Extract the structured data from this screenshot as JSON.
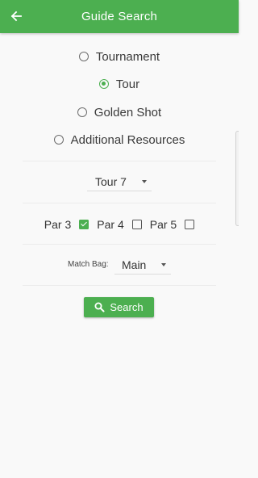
{
  "appbar": {
    "title": "Guide Search",
    "back_icon": "arrow-left-icon"
  },
  "colors": {
    "accent": "#4caf50",
    "background": "#f9f9f9"
  },
  "search_type": {
    "options": [
      {
        "label": "Tournament",
        "selected": false
      },
      {
        "label": "Tour",
        "selected": true
      },
      {
        "label": "Golden Shot",
        "selected": false
      },
      {
        "label": "Additional Resources",
        "selected": false
      }
    ]
  },
  "tour_select": {
    "value": "Tour 7"
  },
  "par_filters": [
    {
      "label": "Par 3",
      "checked": true
    },
    {
      "label": "Par 4",
      "checked": false
    },
    {
      "label": "Par 5",
      "checked": false
    }
  ],
  "match_bag": {
    "label": "Match Bag:",
    "value": "Main"
  },
  "search_button": {
    "label": "Search",
    "icon": "search-icon"
  }
}
